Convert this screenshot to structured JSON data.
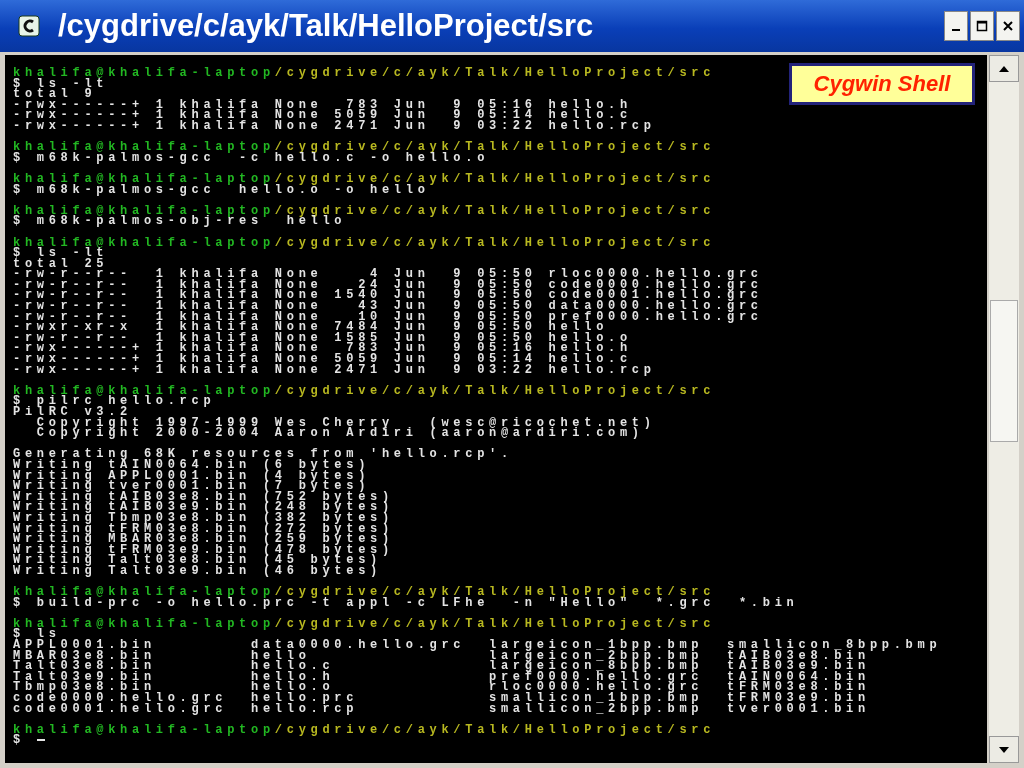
{
  "window": {
    "title": "/cygdrive/c/ayk/Talk/HelloProject/src"
  },
  "label": "Cygwin Shell",
  "terminal": {
    "blocks": [
      {
        "user": "khalifa@khalifa-laptop",
        "path": "/cygdrive/c/ayk/Talk/HelloProject/src",
        "command": "$ ls -lt",
        "output": [
          [
            "total 9",
            "-rwx------+ 1 khalifa None  783 Jun  9 05:16 hello.h",
            "-rwx------+ 1 khalifa None 5059 Jun  9 05:14 hello.c",
            "-rwx------+ 1 khalifa None 2471 Jun  9 03:22 hello.rcp"
          ]
        ]
      },
      {
        "user": "khalifa@khalifa-laptop",
        "path": "/cygdrive/c/ayk/Talk/HelloProject/src",
        "command": "$ m68k-palmos-gcc  -c hello.c -o hello.o"
      },
      {
        "user": "khalifa@khalifa-laptop",
        "path": "/cygdrive/c/ayk/Talk/HelloProject/src",
        "command": "$ m68k-palmos-gcc  hello.o -o hello"
      },
      {
        "user": "khalifa@khalifa-laptop",
        "path": "/cygdrive/c/ayk/Talk/HelloProject/src",
        "command": "$ m68k-palmos-obj-res  hello"
      },
      {
        "user": "khalifa@khalifa-laptop",
        "path": "/cygdrive/c/ayk/Talk/HelloProject/src",
        "command": "$ ls -lt",
        "output": [
          [
            "total 25",
            "-rw-r--r--  1 khalifa None    4 Jun  9 05:50 rloc0000.hello.grc",
            "-rw-r--r--  1 khalifa None   24 Jun  9 05:50 code0000.hello.grc",
            "-rw-r--r--  1 khalifa None 1540 Jun  9 05:50 code0001.hello.grc",
            "-rw-r--r--  1 khalifa None   43 Jun  9 05:50 data0000.hello.grc",
            "-rw-r--r--  1 khalifa None   10 Jun  9 05:50 pref0000.hello.grc",
            "-rwxr-xr-x  1 khalifa None 7484 Jun  9 05:50 hello",
            "-rw-r--r--  1 khalifa None 1585 Jun  9 05:50 hello.o",
            "-rwx------+ 1 khalifa None  783 Jun  9 05:16 hello.h",
            "-rwx------+ 1 khalifa None 5059 Jun  9 05:14 hello.c",
            "-rwx------+ 1 khalifa None 2471 Jun  9 03:22 hello.rcp"
          ]
        ]
      },
      {
        "user": "khalifa@khalifa-laptop",
        "path": "/cygdrive/c/ayk/Talk/HelloProject/src",
        "command": "$ pilrc hello.rcp",
        "output": [
          [
            "PilRC v3.2",
            "  Copyright 1997-1999 Wes Cherry   (wesc@ricochet.net)",
            "  Copyright 2000-2004 Aaron Ardiri (aaron@ardiri.com)"
          ],
          [
            "Generating 68K resources from 'hello.rcp'.",
            "Writing tAIN0064.bin (6 bytes)",
            "Writing APPL0001.bin (4 bytes)",
            "Writing tver0001.bin (7 bytes)",
            "Writing tAIB03e8.bin (752 bytes)",
            "Writing tAIB03e9.bin (248 bytes)",
            "Writing Tbmp03e8.bin (382 bytes)",
            "Writing tFRM03e8.bin (272 bytes)",
            "Writing MBAR03e8.bin (259 bytes)",
            "Writing tFRM03e9.bin (478 bytes)",
            "Writing Talt03e8.bin (45 bytes)",
            "Writing Talt03e9.bin (46 bytes)"
          ]
        ]
      },
      {
        "user": "khalifa@khalifa-laptop",
        "path": "/cygdrive/c/ayk/Talk/HelloProject/src",
        "command": "$ build-prc -o hello.prc -t appl -c LFhe  -n \"Hello\"  *.grc  *.bin"
      },
      {
        "user": "khalifa@khalifa-laptop",
        "path": "/cygdrive/c/ayk/Talk/HelloProject/src",
        "command": "$ ls",
        "output": [
          [
            "APPL0001.bin        data0000.hello.grc  largeicon_1bpp.bmp  smallicon_8bpp.bmp",
            "MBAR03e8.bin        hello               largeicon_2bpp.bmp  tAIB03e8.bin",
            "Talt03e8.bin        hello.c             largeicon_8bpp.bmp  tAIB03e9.bin",
            "Talt03e9.bin        hello.h             pref0000.hello.grc  tAIN0064.bin",
            "Tbmp03e8.bin        hello.o             rloc0000.hello.grc  tFRM03e8.bin",
            "code0000.hello.grc  hello.prc           smallicon_1bpp.bmp  tFRM03e9.bin",
            "code0001.hello.grc  hello.rcp           smallicon_2bpp.bmp  tver0001.bin"
          ]
        ]
      },
      {
        "user": "khalifa@khalifa-laptop",
        "path": "/cygdrive/c/ayk/Talk/HelloProject/src",
        "command": "$ ",
        "cursor": true
      }
    ]
  }
}
